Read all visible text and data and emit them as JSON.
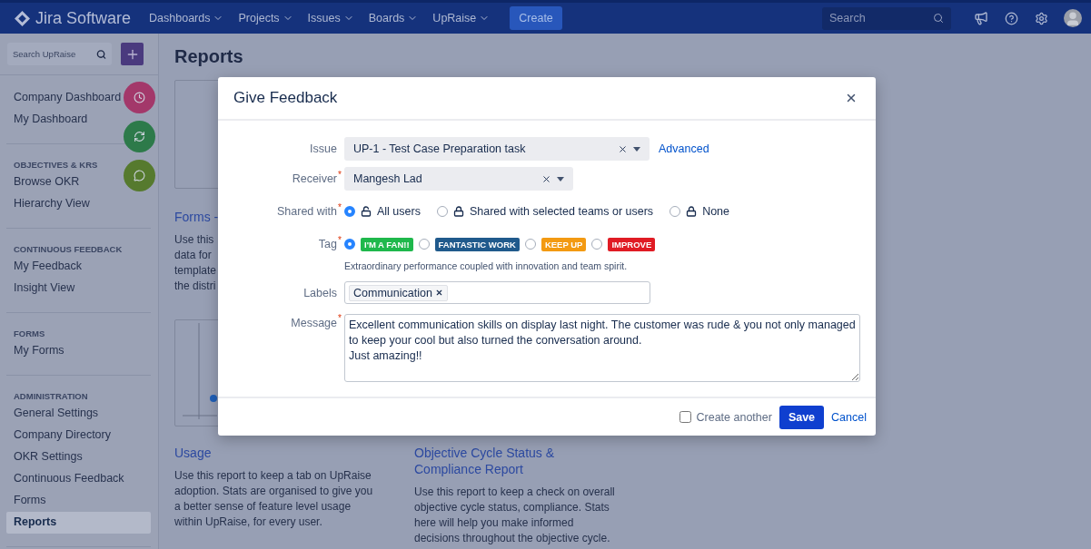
{
  "navbar": {
    "logo": "Jira Software",
    "menus": [
      {
        "label": "Dashboards"
      },
      {
        "label": "Projects"
      },
      {
        "label": "Issues"
      },
      {
        "label": "Boards"
      },
      {
        "label": "UpRaise"
      }
    ],
    "create": "Create",
    "search": {
      "placeholder": "Search"
    }
  },
  "sidebar": {
    "search": {
      "placeholder": "Search UpRaise"
    },
    "groups": [
      {
        "items": [
          {
            "label": "Company Dashboard",
            "selected": false
          },
          {
            "label": "My Dashboard",
            "selected": false
          }
        ]
      },
      {
        "heading": "OBJECTIVES & KRS",
        "items": [
          {
            "label": "Browse OKR",
            "selected": false
          },
          {
            "label": "Hierarchy View",
            "selected": false
          }
        ]
      },
      {
        "heading": "CONTINUOUS FEEDBACK",
        "items": [
          {
            "label": "My Feedback",
            "selected": false
          },
          {
            "label": "Insight View",
            "selected": false
          }
        ]
      },
      {
        "heading": "FORMS",
        "items": [
          {
            "label": "My Forms",
            "selected": false
          }
        ]
      },
      {
        "heading": "ADMINISTRATION",
        "items": [
          {
            "label": "General Settings",
            "selected": false
          },
          {
            "label": "Company Directory",
            "selected": false
          },
          {
            "label": "OKR Settings",
            "selected": false
          },
          {
            "label": "Continuous Feedback",
            "selected": false
          },
          {
            "label": "Forms",
            "selected": false
          },
          {
            "label": "Reports",
            "selected": true
          }
        ]
      }
    ],
    "fabs": [
      {
        "color": "#a3386a"
      },
      {
        "color": "#2d7a4a"
      },
      {
        "color": "#567a2e"
      }
    ]
  },
  "main": {
    "title": "Reports",
    "reports": [
      {
        "title": "Forms -",
        "lines": [
          "Use this",
          "data for",
          "template",
          "the distri"
        ]
      },
      {
        "title": "Usage",
        "lines": [
          "Use this report to keep a tab on UpRaise",
          "adoption. Stats are organised to give you",
          "a better sense of feature level usage",
          "within UpRaise, for every user."
        ]
      },
      {
        "title": "Objective Cycle Status & Compliance Report",
        "lines": [
          "Use this report to keep a check on overall",
          "objective cycle status, compliance. Stats",
          "here will help you make informed",
          "decisions throughout the objective cycle."
        ]
      }
    ]
  },
  "dialog": {
    "title": "Give Feedback",
    "issue": {
      "label": "Issue",
      "value": "UP-1 - Test Case Preparation task",
      "link": "Advanced"
    },
    "receiver": {
      "label": "Receiver",
      "marker": "*",
      "value": "Mangesh Lad"
    },
    "shared": {
      "label": "Shared with",
      "marker": "*",
      "options": [
        {
          "label": "All users",
          "locked": false,
          "selected": true
        },
        {
          "label": "Shared with selected teams or users",
          "locked": true,
          "selected": false
        },
        {
          "label": "None",
          "locked": true,
          "selected": false
        }
      ]
    },
    "tag": {
      "label": "Tag",
      "marker": "*",
      "options": [
        {
          "label": "I'M A FAN!!",
          "color": "#1fb84c",
          "selected": true
        },
        {
          "label": "FANTASTIC WORK",
          "color": "#205a8c",
          "selected": false
        },
        {
          "label": "KEEP UP",
          "color": "#f39a12",
          "selected": false
        },
        {
          "label": "IMPROVE",
          "color": "#e01b24",
          "selected": false
        }
      ],
      "hint": "Extraordinary performance coupled with innovation and team spirit."
    },
    "labels": {
      "label": "Labels",
      "chips": [
        "Communication"
      ]
    },
    "message": {
      "label": "Message",
      "marker": "*",
      "value": "Excellent communication skills on display last night. The customer was rude & you not only managed to keep your cool but also turned the conversation around.\nJust amazing!!"
    },
    "create_another": {
      "label": "Create another",
      "checked": false
    },
    "save": "Save",
    "cancel": "Cancel"
  }
}
